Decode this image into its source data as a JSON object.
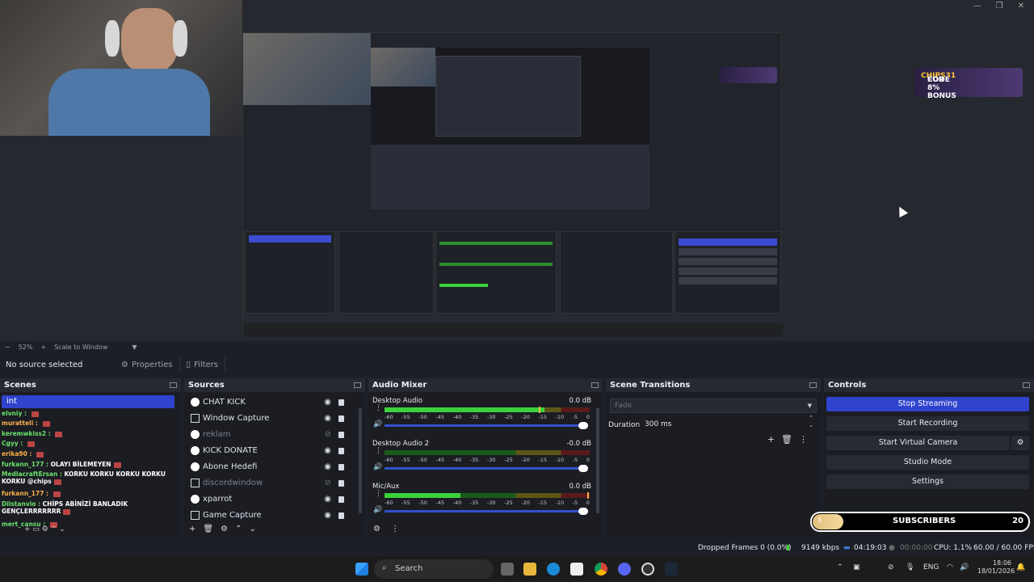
{
  "preview": {
    "code_ad": {
      "line1_prefix": "CODE",
      "code": "CHIPS31",
      "line2": "FOR 8% BONUS"
    }
  },
  "zoom": {
    "minus": "−",
    "value": "52%",
    "plus": "+",
    "mode": "Scale to Window"
  },
  "context": {
    "no_source": "No source selected",
    "properties": "Properties",
    "filters": "Filters"
  },
  "scenes": {
    "title": "Scenes",
    "selected": "int",
    "chat": [
      {
        "user": "elvniy :",
        "msg": ""
      },
      {
        "user": "muratteli :",
        "msg": ""
      },
      {
        "user": "keremwkiss2 :",
        "msg": ""
      },
      {
        "user": "Cgyy :",
        "msg": ""
      },
      {
        "user": "erika90 :",
        "msg": ""
      },
      {
        "user": "furkann_177 :",
        "msg": "OLAYI BİLEMEYEN"
      },
      {
        "user": "MedlacraftErsan :",
        "msg": "KORKU KORKU KORKU KORKU KORKU @chips"
      },
      {
        "user": "furkann_177 :",
        "msg": ""
      },
      {
        "user": "Dilstanvio :",
        "msg": "CHİPS ABİNİZİ BANLADIK GENÇLERRRRRRR"
      },
      {
        "user": "mert_cansu :",
        "msg": ""
      }
    ]
  },
  "sources": {
    "title": "Sources",
    "items": [
      {
        "label": "CHAT KICK",
        "icon": "globe-icon",
        "visible": true
      },
      {
        "label": "Window Capture",
        "icon": "window-icon",
        "visible": true
      },
      {
        "label": "reklam",
        "icon": "globe-icon",
        "visible": false
      },
      {
        "label": "KICK DONATE",
        "icon": "globe-icon",
        "visible": true
      },
      {
        "label": "Abone Hedefi",
        "icon": "globe-icon",
        "visible": true
      },
      {
        "label": "discordwindow",
        "icon": "window-icon",
        "visible": false
      },
      {
        "label": "xparrot",
        "icon": "globe-icon",
        "visible": true
      },
      {
        "label": "Game Capture",
        "icon": "gamepad-icon",
        "visible": true
      }
    ]
  },
  "mixer": {
    "title": "Audio Mixer",
    "ticks": [
      "-60",
      "-55",
      "-50",
      "-45",
      "-40",
      "-35",
      "-30",
      "-25",
      "-20",
      "-15",
      "-10",
      "-5",
      "0"
    ],
    "channels": [
      {
        "name": "Desktop Audio",
        "db": "0.0 dB",
        "level": 0.78,
        "peak": 0.75
      },
      {
        "name": "Desktop Audio 2",
        "db": "-0.0 dB",
        "level": 0.0,
        "peak": 0.0
      },
      {
        "name": "Mic/Aux",
        "db": "0.0 dB",
        "level": 0.37,
        "peak": 0.99
      }
    ]
  },
  "transitions": {
    "title": "Scene Transitions",
    "fade": "Fade",
    "duration_label": "Duration",
    "duration_value": "300 ms"
  },
  "controls": {
    "title": "Controls",
    "stop_streaming": "Stop Streaming",
    "start_recording": "Start Recording",
    "start_virtual_camera": "Start Virtual Camera",
    "studio_mode": "Studio Mode",
    "settings": "Settings"
  },
  "subscribers": {
    "progress": "3",
    "label": "SUBSCRIBERS",
    "goal": "20"
  },
  "status": {
    "dropped": "Dropped Frames 0 (0.0%)",
    "kbps": "9149 kbps",
    "live_time": "04:19:03",
    "rec_time": "00:00:00",
    "cpu": "CPU: 1.1%",
    "fps": "60.00 / 60.00 FPS"
  },
  "taskbar": {
    "search": "Search",
    "lang": "ENG",
    "time": "18:06",
    "date": "18/01/2026"
  },
  "colors": {
    "accent": "#2f43cc",
    "meter_green": "#3bd13b",
    "bg": "#1d1f26"
  }
}
